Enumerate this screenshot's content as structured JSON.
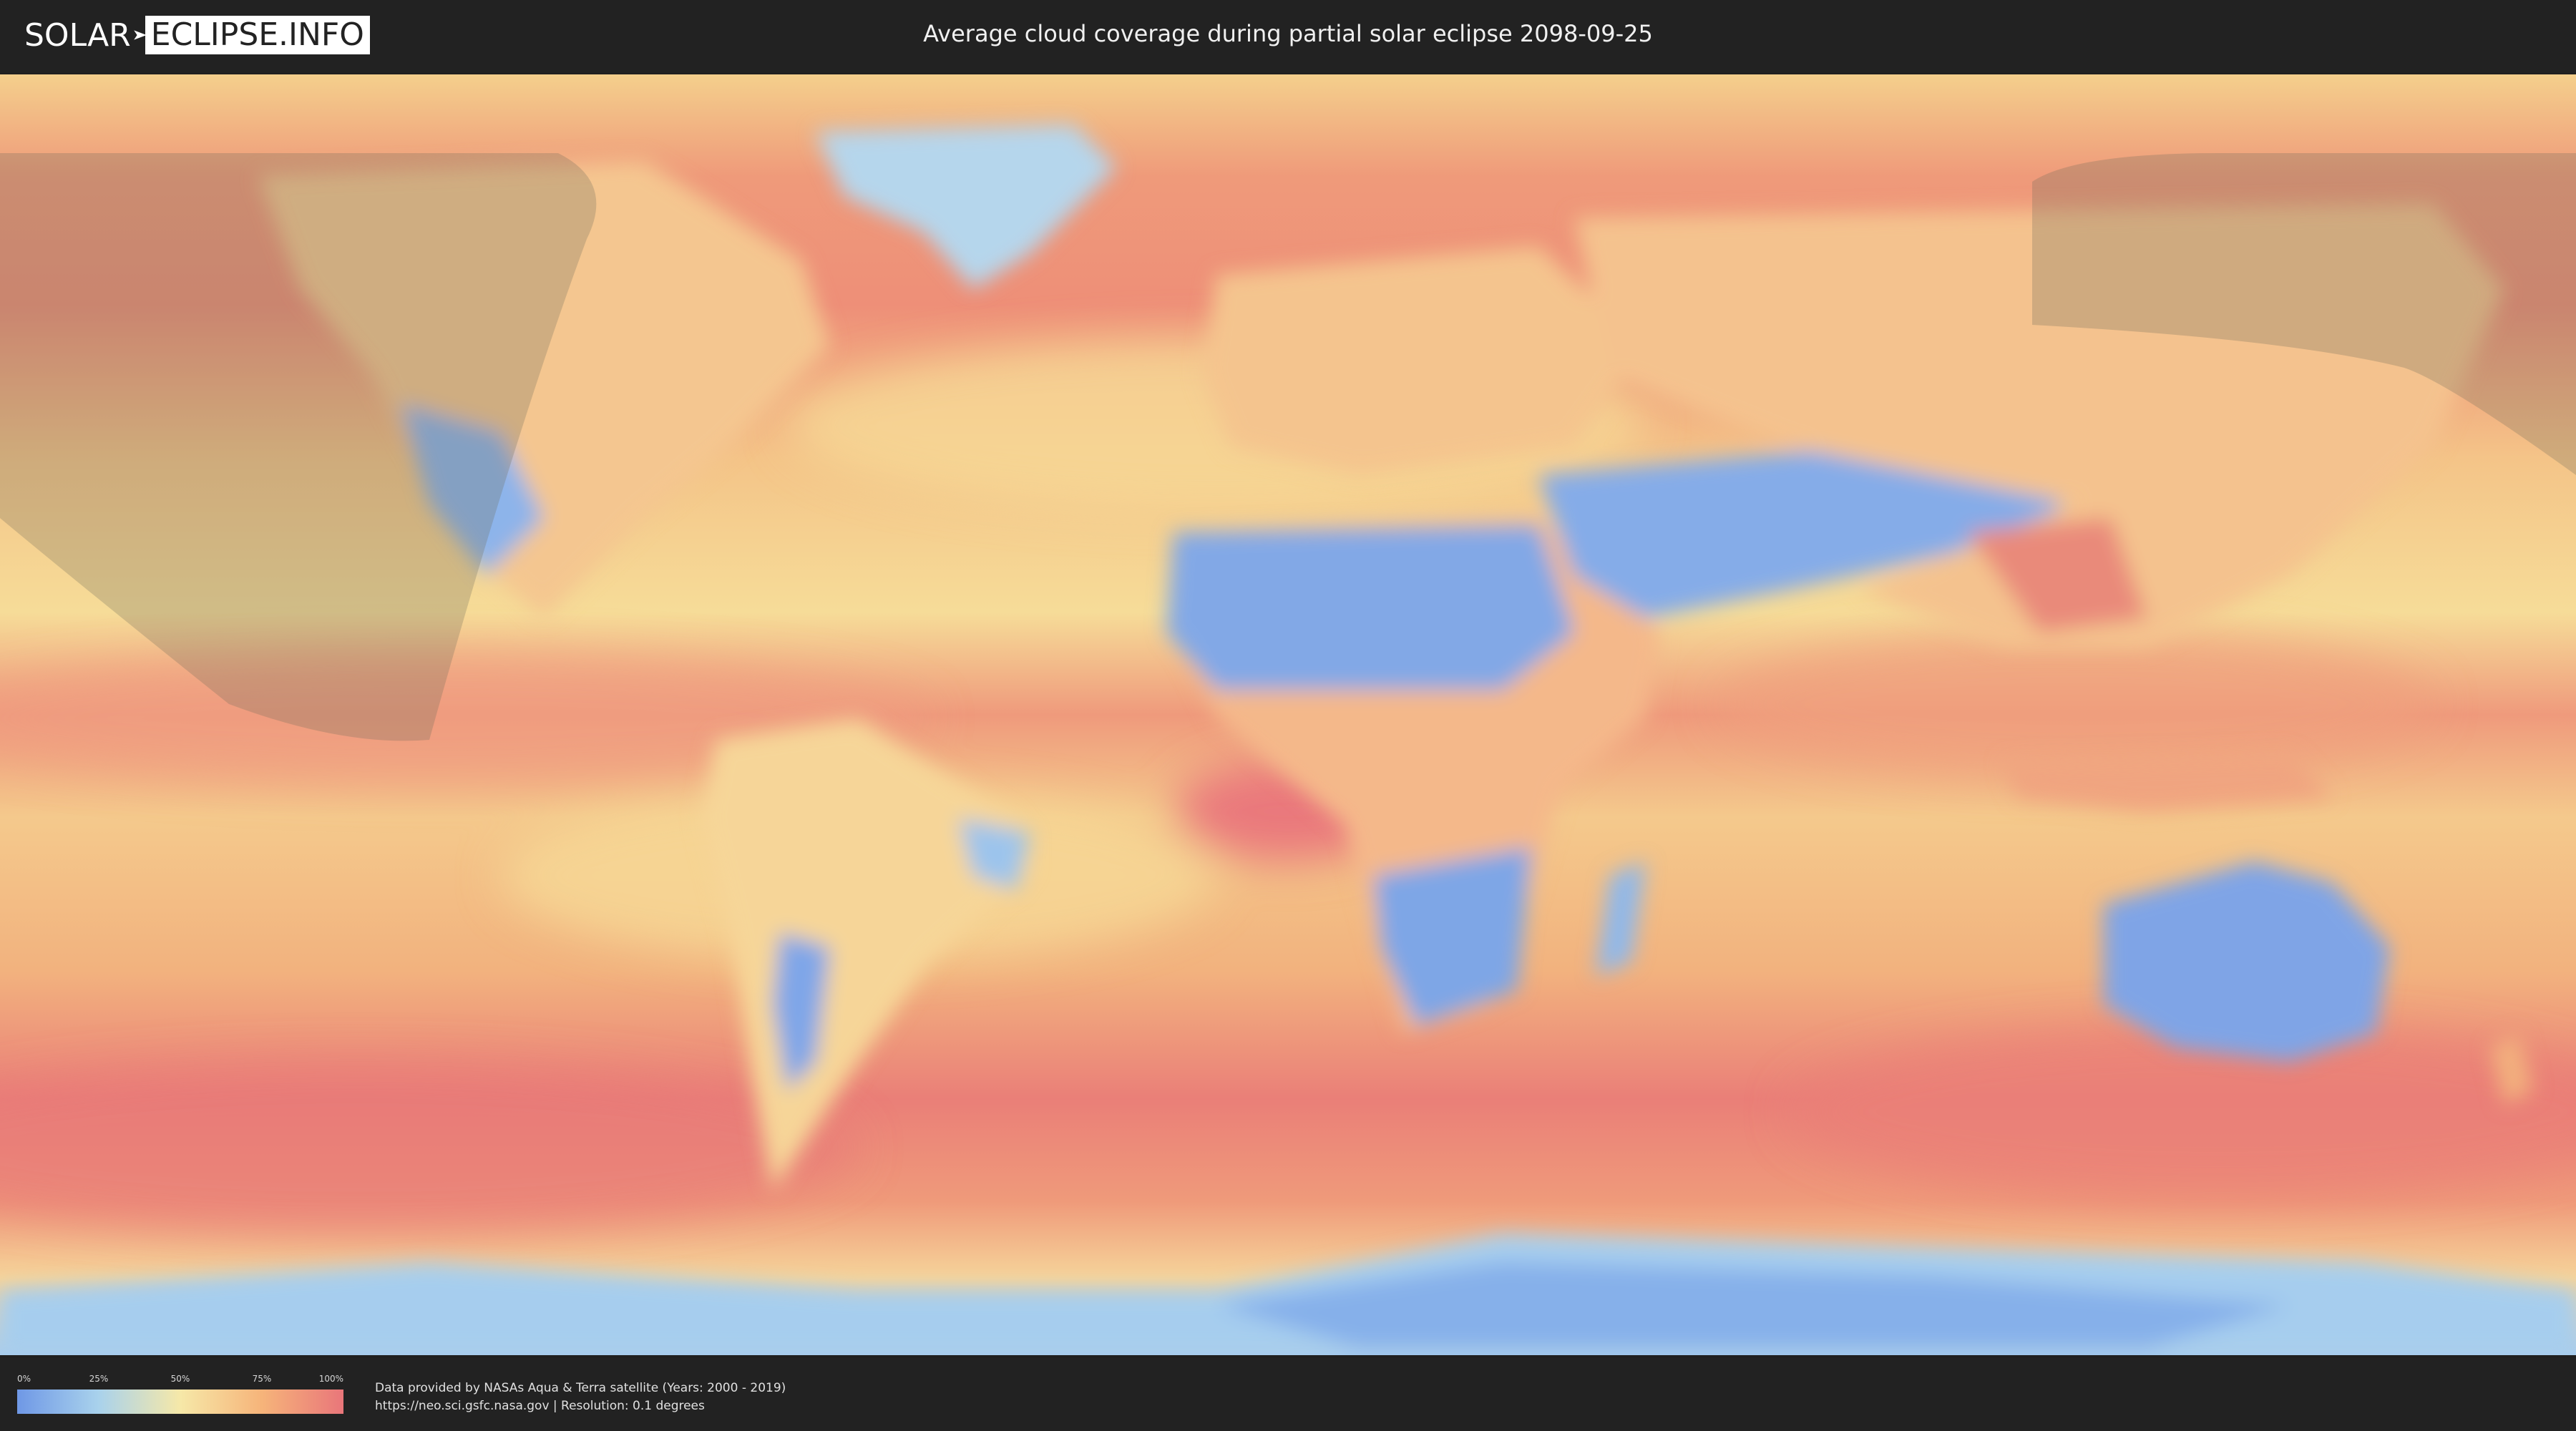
{
  "header": {
    "logo_left": "SOLAR",
    "logo_right": "ECLIPSE.INFO",
    "title": "Average cloud coverage during partial solar eclipse 2098-09-25"
  },
  "legend": {
    "ticks": [
      "0%",
      "25%",
      "50%",
      "75%",
      "100%"
    ],
    "colors": [
      "#6f98e6",
      "#a9d2ec",
      "#f6e8a8",
      "#f6b47a",
      "#e9767a"
    ]
  },
  "footer": {
    "line1": "Data provided by NASAs Aqua & Terra satellite (Years: 2000 - 2019)",
    "line2": "https://neo.sci.gsfc.nasa.gov | Resolution: 0.1 degrees"
  }
}
